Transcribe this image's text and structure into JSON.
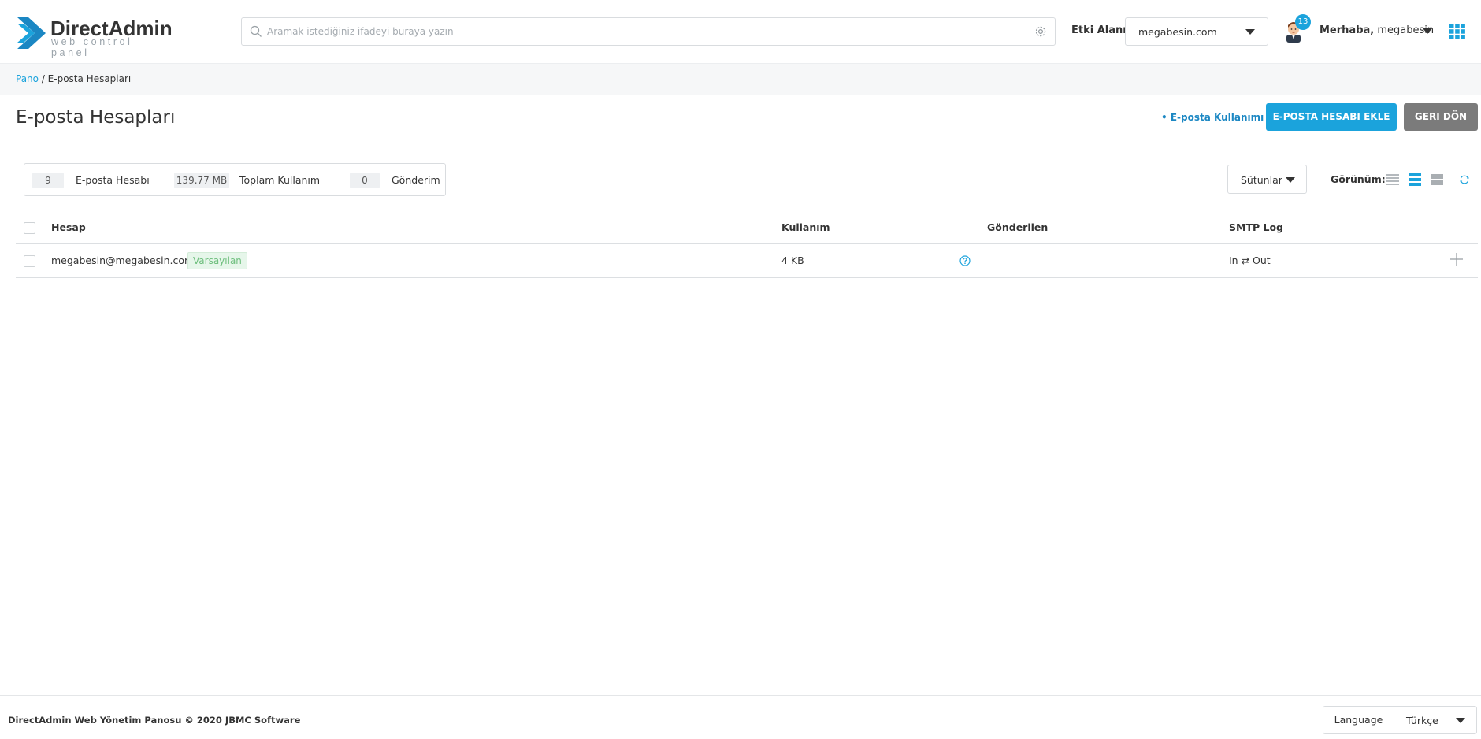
{
  "app": {
    "logo_name": "DirectAdmin",
    "logo_tagline": "web control panel"
  },
  "search": {
    "placeholder": "Aramak istediğiniz ifadeyi buraya yazın"
  },
  "domain": {
    "label": "Etki Alanı",
    "selected": "megabesin.com"
  },
  "user": {
    "notification_count": "13",
    "greeting_prefix": "Merhaba,",
    "username": "megabesin"
  },
  "breadcrumb": {
    "home": "Pano",
    "separator": " / ",
    "current": "E-posta Hesapları"
  },
  "page": {
    "title": "E-posta Hesapları",
    "usage_link": "• E-posta Kullanımı",
    "add_button": "E-POSTA HESABI EKLE",
    "back_button": "GERI DÖN"
  },
  "stats": [
    {
      "value": "9",
      "label": "E-posta Hesabı"
    },
    {
      "value": "139.77 MB",
      "label": "Toplam Kullanım"
    },
    {
      "value": "0",
      "label": "Gönderim"
    }
  ],
  "toolbar": {
    "columns_label": "Sütunlar",
    "view_label": "Görünüm:"
  },
  "table": {
    "headers": [
      "Hesap",
      "Kullanım",
      "Gönderilen",
      "SMTP Log"
    ],
    "rows": [
      {
        "account": "megabesin@megabesin.com",
        "badge": "Varsayılan",
        "usage": "4 KB",
        "sent": "",
        "smtp_log": "In ⇄ Out"
      }
    ]
  },
  "footer": {
    "copyright": "DirectAdmin Web Yönetim Panosu © 2020 JBMC Software",
    "language_label": "Language",
    "language_value": "Türkçe"
  },
  "colors": {
    "accent": "#1ba3dc",
    "secondary_button": "#7b7b7b",
    "badge_text": "#6fbf7e"
  }
}
